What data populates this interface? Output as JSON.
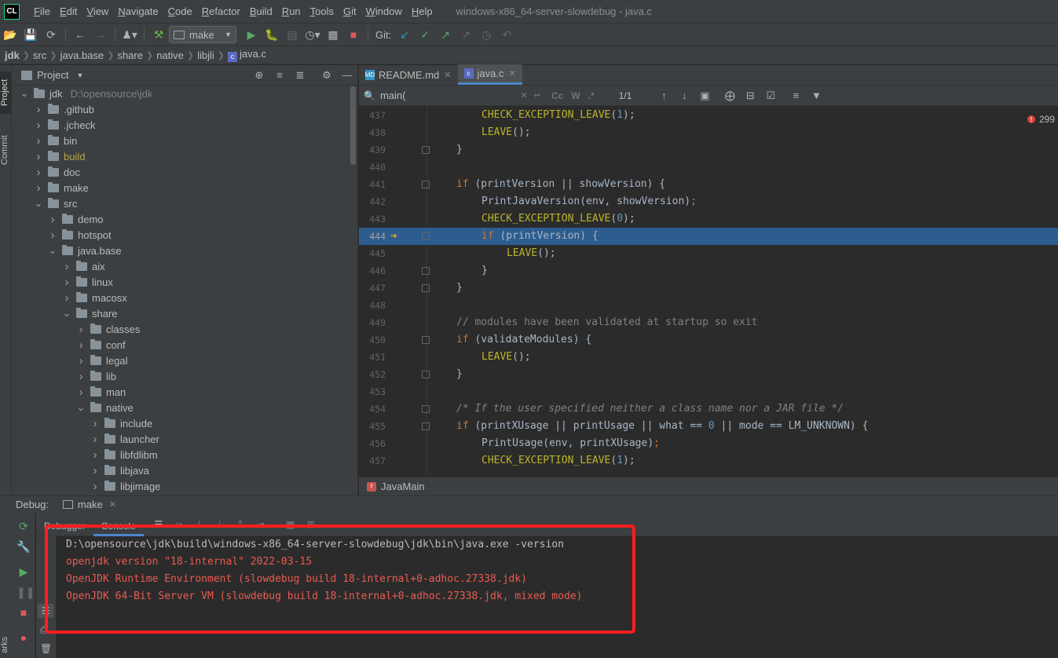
{
  "app": {
    "logo_text": "CL",
    "window_title": "windows-x86_64-server-slowdebug - java.c"
  },
  "menu": [
    "File",
    "Edit",
    "View",
    "Navigate",
    "Code",
    "Refactor",
    "Build",
    "Run",
    "Tools",
    "Git",
    "Window",
    "Help"
  ],
  "toolbar": {
    "run_config": "make",
    "git_label": "Git:"
  },
  "breadcrumb": [
    "jdk",
    "src",
    "java.base",
    "share",
    "native",
    "libjli",
    "java.c"
  ],
  "left_stripe": {
    "project_tab": "Project",
    "commit_tab": "Commit"
  },
  "project": {
    "title": "Project",
    "root_label": "jdk",
    "root_path": "D:\\opensource\\jdk",
    "tree": [
      {
        "label": "jdk",
        "depth": 0,
        "expanded": true,
        "path": "D:\\opensource\\jdk"
      },
      {
        "label": ".github",
        "depth": 1,
        "expanded": false
      },
      {
        "label": ".jcheck",
        "depth": 1,
        "expanded": false
      },
      {
        "label": "bin",
        "depth": 1,
        "expanded": false
      },
      {
        "label": "build",
        "depth": 1,
        "expanded": false,
        "excluded": true
      },
      {
        "label": "doc",
        "depth": 1,
        "expanded": false
      },
      {
        "label": "make",
        "depth": 1,
        "expanded": false
      },
      {
        "label": "src",
        "depth": 1,
        "expanded": true
      },
      {
        "label": "demo",
        "depth": 2,
        "expanded": false
      },
      {
        "label": "hotspot",
        "depth": 2,
        "expanded": false
      },
      {
        "label": "java.base",
        "depth": 2,
        "expanded": true
      },
      {
        "label": "aix",
        "depth": 3,
        "expanded": false
      },
      {
        "label": "linux",
        "depth": 3,
        "expanded": false
      },
      {
        "label": "macosx",
        "depth": 3,
        "expanded": false
      },
      {
        "label": "share",
        "depth": 3,
        "expanded": true
      },
      {
        "label": "classes",
        "depth": 4,
        "expanded": false
      },
      {
        "label": "conf",
        "depth": 4,
        "expanded": false
      },
      {
        "label": "legal",
        "depth": 4,
        "expanded": false
      },
      {
        "label": "lib",
        "depth": 4,
        "expanded": false
      },
      {
        "label": "man",
        "depth": 4,
        "expanded": false
      },
      {
        "label": "native",
        "depth": 4,
        "expanded": true
      },
      {
        "label": "include",
        "depth": 5,
        "expanded": false
      },
      {
        "label": "launcher",
        "depth": 5,
        "expanded": false
      },
      {
        "label": "libfdlibm",
        "depth": 5,
        "expanded": false
      },
      {
        "label": "libjava",
        "depth": 5,
        "expanded": false
      },
      {
        "label": "libjimage",
        "depth": 5,
        "expanded": false
      }
    ]
  },
  "editor": {
    "tabs": [
      {
        "label": "README.md",
        "active": false,
        "icon": "markdown-file-icon"
      },
      {
        "label": "java.c",
        "active": true,
        "icon": "c-file-icon"
      }
    ],
    "find": {
      "query": "main(",
      "match_count": "1/1",
      "opt_case": "Cc",
      "opt_word": "W",
      "opt_regex": ".*"
    },
    "error_count": "299",
    "current_line": 444,
    "function_crumb": "JavaMain",
    "lines": [
      {
        "num": "437",
        "indent": 2,
        "tokens": [
          [
            "mac",
            "CHECK_EXCEPTION_LEAVE"
          ],
          [
            "t",
            "("
          ],
          [
            "num",
            "1"
          ],
          [
            "t",
            ");"
          ]
        ]
      },
      {
        "num": "438",
        "indent": 2,
        "tokens": [
          [
            "mac",
            "LEAVE"
          ],
          [
            "t",
            "();"
          ]
        ]
      },
      {
        "num": "439",
        "indent": 1,
        "tokens": [
          [
            "t",
            "}"
          ]
        ],
        "fold": true
      },
      {
        "num": "440",
        "indent": 0,
        "tokens": []
      },
      {
        "num": "441",
        "indent": 1,
        "tokens": [
          [
            "kw",
            "if"
          ],
          [
            "t",
            " (printVersion || showVersion) {"
          ]
        ],
        "fold": true
      },
      {
        "num": "442",
        "indent": 2,
        "tokens": [
          [
            "t",
            "PrintJavaVersion(env, showVersion)"
          ],
          [
            "kw",
            ";"
          ]
        ]
      },
      {
        "num": "443",
        "indent": 2,
        "tokens": [
          [
            "mac",
            "CHECK_EXCEPTION_LEAVE"
          ],
          [
            "t",
            "("
          ],
          [
            "num",
            "0"
          ],
          [
            "t",
            ");"
          ]
        ]
      },
      {
        "num": "444",
        "indent": 2,
        "tokens": [
          [
            "kw",
            "if"
          ],
          [
            "t",
            " (printVersion) {"
          ]
        ],
        "fold": true,
        "current": true
      },
      {
        "num": "445",
        "indent": 3,
        "tokens": [
          [
            "mac",
            "LEAVE"
          ],
          [
            "t",
            "();"
          ]
        ]
      },
      {
        "num": "446",
        "indent": 2,
        "tokens": [
          [
            "t",
            "}"
          ]
        ],
        "fold": true
      },
      {
        "num": "447",
        "indent": 1,
        "tokens": [
          [
            "t",
            "}"
          ]
        ],
        "fold": true
      },
      {
        "num": "448",
        "indent": 0,
        "tokens": []
      },
      {
        "num": "449",
        "indent": 1,
        "tokens": [
          [
            "cmt",
            "// modules have been validated at startup so exit"
          ]
        ]
      },
      {
        "num": "450",
        "indent": 1,
        "tokens": [
          [
            "kw",
            "if"
          ],
          [
            "t",
            " (validateModules) {"
          ]
        ],
        "fold": true
      },
      {
        "num": "451",
        "indent": 2,
        "tokens": [
          [
            "mac",
            "LEAVE"
          ],
          [
            "t",
            "();"
          ]
        ]
      },
      {
        "num": "452",
        "indent": 1,
        "tokens": [
          [
            "t",
            "}"
          ]
        ],
        "fold": true
      },
      {
        "num": "453",
        "indent": 0,
        "tokens": []
      },
      {
        "num": "454",
        "indent": 1,
        "tokens": [
          [
            "cmtb",
            "/* If the user specified neither a class name nor a JAR file */"
          ]
        ],
        "fold": true
      },
      {
        "num": "455",
        "indent": 1,
        "tokens": [
          [
            "kw",
            "if"
          ],
          [
            "t",
            " (printXUsage || printUsage || what == "
          ],
          [
            "num",
            "0"
          ],
          [
            "t",
            " || mode == LM_UNKNOWN) {"
          ]
        ],
        "fold": true
      },
      {
        "num": "456",
        "indent": 2,
        "tokens": [
          [
            "t",
            "PrintUsage(env, printXUsage)"
          ],
          [
            "kw",
            ";"
          ]
        ]
      },
      {
        "num": "457",
        "indent": 2,
        "tokens": [
          [
            "mac",
            "CHECK_EXCEPTION_LEAVE"
          ],
          [
            "t",
            "("
          ],
          [
            "num",
            "1"
          ],
          [
            "t",
            ");"
          ]
        ]
      }
    ]
  },
  "debug": {
    "label": "Debug:",
    "session": "make",
    "tabs": [
      "Debugger",
      "Console"
    ],
    "active_tab": "Console",
    "console": [
      {
        "text": "D:\\opensource\\jdk\\build\\windows-x86_64-server-slowdebug\\jdk\\bin\\java.exe -version",
        "color": "#bbbbbb"
      },
      {
        "text": "openjdk version \"18-internal\" 2022-03-15",
        "color": "#e85b52"
      },
      {
        "text": "OpenJDK Runtime Environment (slowdebug build 18-internal+0-adhoc.27338.jdk)",
        "color": "#e85b52"
      },
      {
        "text": "OpenJDK 64-Bit Server VM (slowdebug build 18-internal+0-adhoc.27338.jdk, mixed mode)",
        "color": "#e85b52"
      }
    ],
    "highlight_color": "#ff1e1e",
    "side_stripe_fragment": "arks"
  }
}
